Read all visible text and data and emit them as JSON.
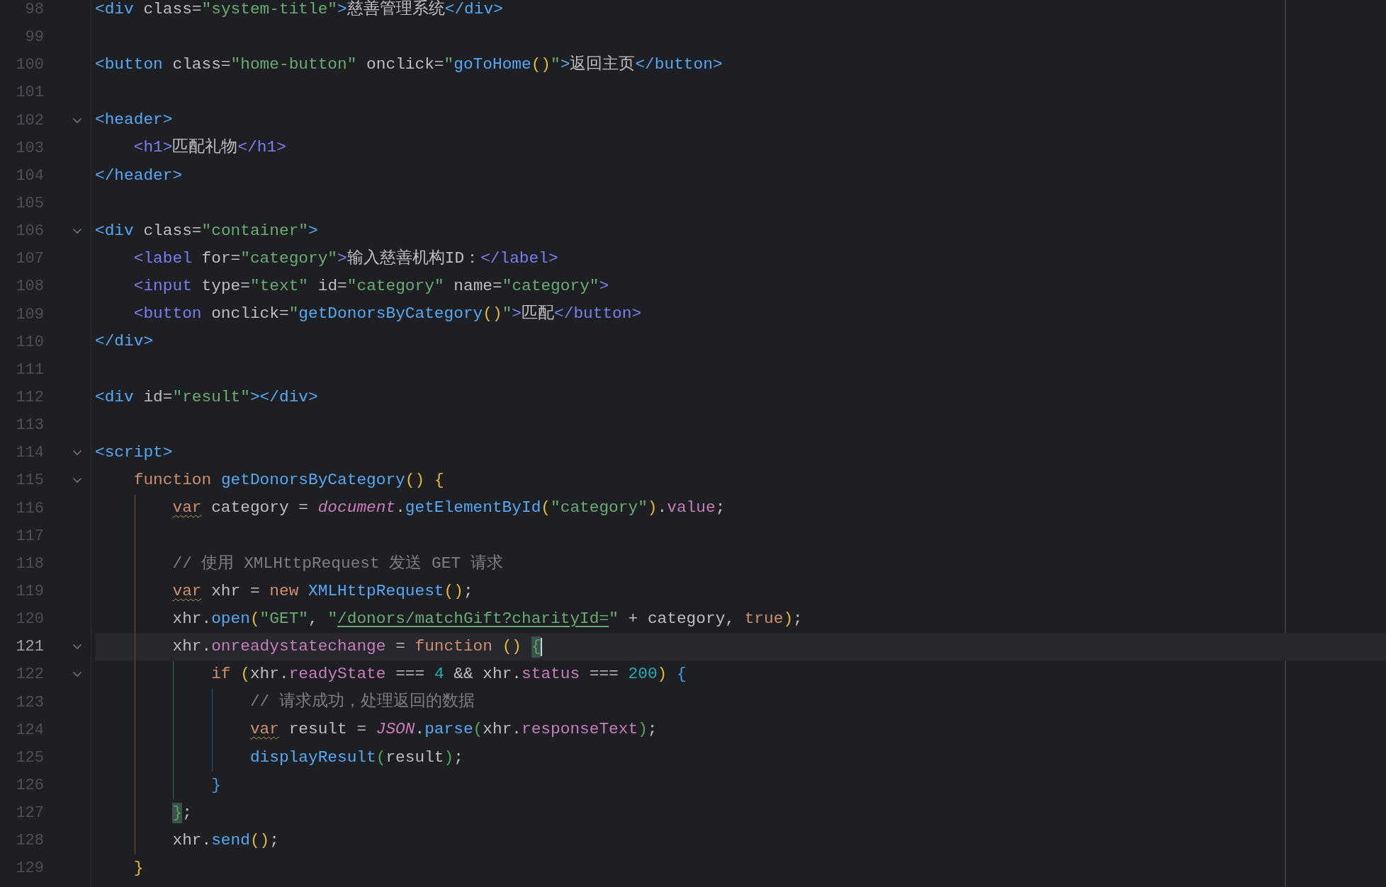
{
  "editor": {
    "lines": [
      {
        "number": "98",
        "foldable": false,
        "current": false,
        "tokens": [
          {
            "text": "<div",
            "kind": "tag"
          },
          {
            "text": " class",
            "kind": "attr"
          },
          {
            "text": "=",
            "kind": "punc"
          },
          {
            "text": "\"system-title\"",
            "kind": "str"
          },
          {
            "text": ">",
            "kind": "tag"
          },
          {
            "text": "慈善管理系统",
            "kind": "text"
          },
          {
            "text": "</div>",
            "kind": "tag"
          }
        ]
      },
      {
        "number": "99",
        "foldable": false,
        "current": false
      },
      {
        "number": "100",
        "foldable": false,
        "current": false,
        "tokens": [
          {
            "text": "<button",
            "kind": "tag"
          },
          {
            "text": " class",
            "kind": "attr"
          },
          {
            "text": "=",
            "kind": "punc"
          },
          {
            "text": "\"home-button\"",
            "kind": "str"
          },
          {
            "text": " onclick",
            "kind": "attr"
          },
          {
            "text": "=",
            "kind": "punc"
          },
          {
            "text": "\"",
            "kind": "str"
          },
          {
            "text": "goToHome",
            "kind": "fn"
          },
          {
            "text": "()",
            "kind": "b1"
          },
          {
            "text": "\"",
            "kind": "str"
          },
          {
            "text": ">",
            "kind": "tag"
          },
          {
            "text": "返回主页",
            "kind": "text"
          },
          {
            "text": "</button>",
            "kind": "tag"
          }
        ]
      },
      {
        "number": "101",
        "foldable": false,
        "current": false
      },
      {
        "number": "102",
        "foldable": true,
        "current": false,
        "tokens": [
          {
            "text": "<header>",
            "kind": "tag"
          }
        ]
      },
      {
        "number": "103",
        "foldable": false,
        "current": false,
        "tokens": [
          {
            "text": "    <h1>",
            "kind": "tag2"
          },
          {
            "text": "匹配礼物",
            "kind": "text"
          },
          {
            "text": "</h1>",
            "kind": "tag2"
          }
        ]
      },
      {
        "number": "104",
        "foldable": false,
        "current": false,
        "tokens": [
          {
            "text": "</header>",
            "kind": "tag"
          }
        ]
      },
      {
        "number": "105",
        "foldable": false,
        "current": false
      },
      {
        "number": "106",
        "foldable": true,
        "current": false,
        "tokens": [
          {
            "text": "<div",
            "kind": "tag"
          },
          {
            "text": " class",
            "kind": "attr"
          },
          {
            "text": "=",
            "kind": "punc"
          },
          {
            "text": "\"container\"",
            "kind": "str"
          },
          {
            "text": ">",
            "kind": "tag"
          }
        ]
      },
      {
        "number": "107",
        "foldable": false,
        "current": false,
        "tokens": [
          {
            "text": "    <label",
            "kind": "tag2"
          },
          {
            "text": " for",
            "kind": "attr"
          },
          {
            "text": "=",
            "kind": "punc"
          },
          {
            "text": "\"category\"",
            "kind": "str"
          },
          {
            "text": ">",
            "kind": "tag2"
          },
          {
            "text": "输入慈善机构ID：",
            "kind": "text"
          },
          {
            "text": "</label>",
            "kind": "tag2"
          }
        ]
      },
      {
        "number": "108",
        "foldable": false,
        "current": false,
        "tokens": [
          {
            "text": "    <input",
            "kind": "tag2"
          },
          {
            "text": " type",
            "kind": "attr"
          },
          {
            "text": "=",
            "kind": "punc"
          },
          {
            "text": "\"text\"",
            "kind": "str"
          },
          {
            "text": " id",
            "kind": "attr"
          },
          {
            "text": "=",
            "kind": "punc"
          },
          {
            "text": "\"category\"",
            "kind": "str"
          },
          {
            "text": " name",
            "kind": "attr"
          },
          {
            "text": "=",
            "kind": "punc"
          },
          {
            "text": "\"category\"",
            "kind": "str"
          },
          {
            "text": ">",
            "kind": "tag2"
          }
        ]
      },
      {
        "number": "109",
        "foldable": false,
        "current": false,
        "tokens": [
          {
            "text": "    <button",
            "kind": "tag2"
          },
          {
            "text": " onclick",
            "kind": "attr"
          },
          {
            "text": "=",
            "kind": "punc"
          },
          {
            "text": "\"",
            "kind": "str"
          },
          {
            "text": "getDonorsByCategory",
            "kind": "fn"
          },
          {
            "text": "()",
            "kind": "b1"
          },
          {
            "text": "\"",
            "kind": "str"
          },
          {
            "text": ">",
            "kind": "tag2"
          },
          {
            "text": "匹配",
            "kind": "text"
          },
          {
            "text": "</button>",
            "kind": "tag2"
          }
        ]
      },
      {
        "number": "110",
        "foldable": false,
        "current": false,
        "tokens": [
          {
            "text": "</div>",
            "kind": "tag"
          }
        ]
      },
      {
        "number": "111",
        "foldable": false,
        "current": false
      },
      {
        "number": "112",
        "foldable": false,
        "current": false,
        "tokens": [
          {
            "text": "<div",
            "kind": "tag"
          },
          {
            "text": " id",
            "kind": "attr"
          },
          {
            "text": "=",
            "kind": "punc"
          },
          {
            "text": "\"result\"",
            "kind": "str"
          },
          {
            "text": "></div>",
            "kind": "tag"
          }
        ]
      },
      {
        "number": "113",
        "foldable": false,
        "current": false
      },
      {
        "number": "114",
        "foldable": true,
        "current": false,
        "tokens": [
          {
            "text": "<script>",
            "kind": "tag"
          }
        ]
      },
      {
        "number": "115",
        "foldable": true,
        "current": false,
        "tokens": [
          {
            "text": "    function",
            "kind": "kw"
          },
          {
            "text": " getDonorsByCategory",
            "kind": "fn"
          },
          {
            "text": "()",
            "kind": "b1"
          },
          {
            "text": " {",
            "kind": "b1"
          }
        ]
      },
      {
        "number": "116",
        "foldable": false,
        "current": false,
        "tokens": [
          {
            "text": "        var",
            "kind": "kw",
            "warning": true
          },
          {
            "text": " category = ",
            "kind": "punc"
          },
          {
            "text": "document",
            "kind": "glob"
          },
          {
            "text": ".",
            "kind": "punc"
          },
          {
            "text": "getElementById",
            "kind": "fn"
          },
          {
            "text": "(",
            "kind": "b1"
          },
          {
            "text": "\"category\"",
            "kind": "str"
          },
          {
            "text": ")",
            "kind": "b1"
          },
          {
            "text": ".",
            "kind": "punc"
          },
          {
            "text": "value",
            "kind": "prop"
          },
          {
            "text": ";",
            "kind": "punc"
          }
        ]
      },
      {
        "number": "117",
        "foldable": false,
        "current": false
      },
      {
        "number": "118",
        "foldable": false,
        "current": false,
        "tokens": [
          {
            "text": "        // 使用 XMLHttpRequest 发送 GET 请求",
            "kind": "cmt"
          }
        ]
      },
      {
        "number": "119",
        "foldable": false,
        "current": false,
        "tokens": [
          {
            "text": "        var",
            "kind": "kw",
            "warning": true
          },
          {
            "text": " xhr = ",
            "kind": "punc"
          },
          {
            "text": "new",
            "kind": "kw"
          },
          {
            "text": " XMLHttpRequest",
            "kind": "fn"
          },
          {
            "text": "()",
            "kind": "b1"
          },
          {
            "text": ";",
            "kind": "punc"
          }
        ]
      },
      {
        "number": "120",
        "foldable": false,
        "current": false,
        "tokens": [
          {
            "text": "        xhr.",
            "kind": "punc"
          },
          {
            "text": "open",
            "kind": "fn"
          },
          {
            "text": "(",
            "kind": "b1"
          },
          {
            "text": "\"GET\"",
            "kind": "str"
          },
          {
            "text": ", ",
            "kind": "punc"
          },
          {
            "text": "\"",
            "kind": "str"
          },
          {
            "text": "/donors/matchGift?charityId=",
            "kind": "str",
            "underlined": true
          },
          {
            "text": "\"",
            "kind": "str"
          },
          {
            "text": " + category, ",
            "kind": "punc"
          },
          {
            "text": "true",
            "kind": "kw"
          },
          {
            "text": ")",
            "kind": "b1"
          },
          {
            "text": ";",
            "kind": "punc"
          }
        ]
      },
      {
        "number": "121",
        "foldable": true,
        "current": true,
        "tokens": [
          {
            "text": "        xhr.",
            "kind": "punc"
          },
          {
            "text": "onreadystatechange",
            "kind": "prop"
          },
          {
            "text": " = ",
            "kind": "punc"
          },
          {
            "text": "function",
            "kind": "kw"
          },
          {
            "text": " () ",
            "kind": "b1"
          },
          {
            "text": "{",
            "kind": "b3",
            "matched": true
          }
        ]
      },
      {
        "number": "122",
        "foldable": true,
        "current": false,
        "tokens": [
          {
            "text": "            if",
            "kind": "kw"
          },
          {
            "text": " (",
            "kind": "b1"
          },
          {
            "text": "xhr.",
            "kind": "punc"
          },
          {
            "text": "readyState",
            "kind": "prop"
          },
          {
            "text": " === ",
            "kind": "punc"
          },
          {
            "text": "4",
            "kind": "num"
          },
          {
            "text": " && xhr.",
            "kind": "punc"
          },
          {
            "text": "status",
            "kind": "prop"
          },
          {
            "text": " === ",
            "kind": "punc"
          },
          {
            "text": "200",
            "kind": "num"
          },
          {
            "text": ")",
            "kind": "b1"
          },
          {
            "text": " {",
            "kind": "b2"
          }
        ]
      },
      {
        "number": "123",
        "foldable": false,
        "current": false,
        "tokens": [
          {
            "text": "                // 请求成功，处理返回的数据",
            "kind": "cmt"
          }
        ]
      },
      {
        "number": "124",
        "foldable": false,
        "current": false,
        "tokens": [
          {
            "text": "                var",
            "kind": "kw",
            "warning": true
          },
          {
            "text": " result = ",
            "kind": "punc"
          },
          {
            "text": "JSON",
            "kind": "glob"
          },
          {
            "text": ".",
            "kind": "punc"
          },
          {
            "text": "parse",
            "kind": "fn"
          },
          {
            "text": "(",
            "kind": "b3"
          },
          {
            "text": "xhr.",
            "kind": "punc"
          },
          {
            "text": "responseText",
            "kind": "prop"
          },
          {
            "text": ")",
            "kind": "b3"
          },
          {
            "text": ";",
            "kind": "punc"
          }
        ]
      },
      {
        "number": "125",
        "foldable": false,
        "current": false,
        "tokens": [
          {
            "text": "                displayResult",
            "kind": "fn"
          },
          {
            "text": "(",
            "kind": "b3"
          },
          {
            "text": "result",
            "kind": "punc"
          },
          {
            "text": ")",
            "kind": "b3"
          },
          {
            "text": ";",
            "kind": "punc"
          }
        ]
      },
      {
        "number": "126",
        "foldable": false,
        "current": false,
        "tokens": [
          {
            "text": "            }",
            "kind": "b2"
          }
        ]
      },
      {
        "number": "127",
        "foldable": false,
        "current": false,
        "tokens": [
          {
            "text": "        }",
            "kind": "b3",
            "matched": true
          },
          {
            "text": ";",
            "kind": "punc"
          }
        ]
      },
      {
        "number": "128",
        "foldable": false,
        "current": false,
        "tokens": [
          {
            "text": "        xhr.",
            "kind": "punc"
          },
          {
            "text": "send",
            "kind": "fn"
          },
          {
            "text": "()",
            "kind": "b1"
          },
          {
            "text": ";",
            "kind": "punc"
          }
        ]
      },
      {
        "number": "129",
        "foldable": false,
        "current": false,
        "tokens": [
          {
            "text": "    }",
            "kind": "b1"
          }
        ]
      }
    ]
  }
}
